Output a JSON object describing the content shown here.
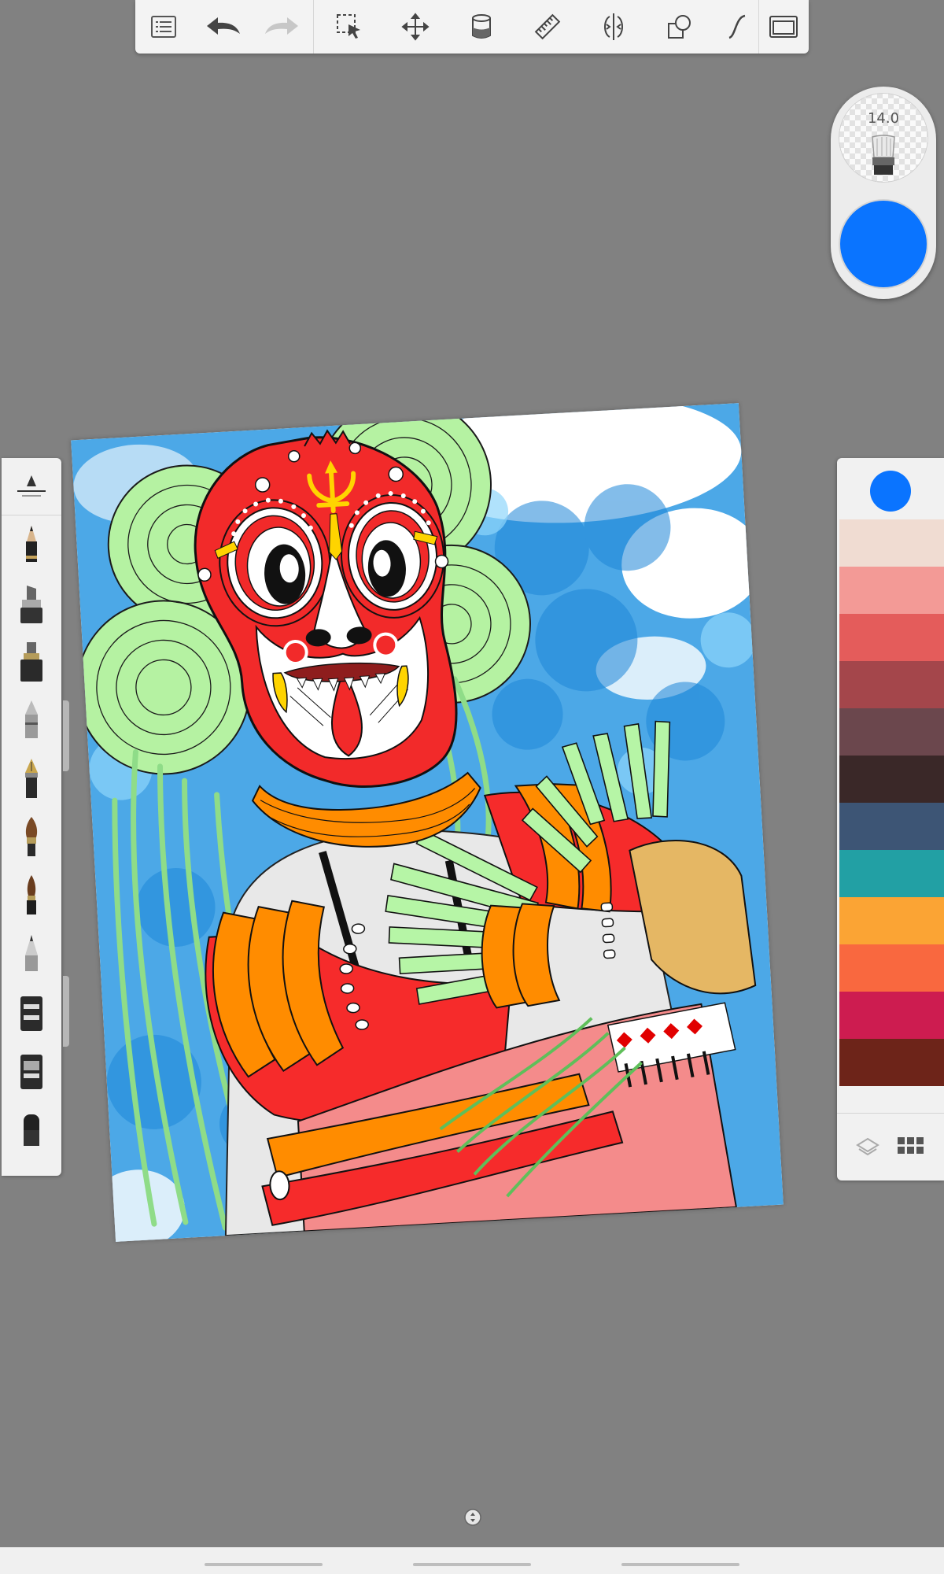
{
  "toolbar": {
    "items": [
      {
        "name": "gallery-button",
        "icon": "list-icon"
      },
      {
        "name": "undo-button",
        "icon": "undo-arrow-icon"
      },
      {
        "name": "redo-button",
        "icon": "redo-arrow-icon",
        "disabled": true
      },
      {
        "name": "selection-button",
        "icon": "selection-icon"
      },
      {
        "name": "transform-button",
        "icon": "move-arrows-icon"
      },
      {
        "name": "fill-button",
        "icon": "paint-bucket-icon"
      },
      {
        "name": "ruler-button",
        "icon": "ruler-icon"
      },
      {
        "name": "symmetry-button",
        "icon": "symmetry-icon"
      },
      {
        "name": "shapes-button",
        "icon": "shapes-icon"
      },
      {
        "name": "curve-button",
        "icon": "curve-icon"
      },
      {
        "name": "fullscreen-button",
        "icon": "fullscreen-icon"
      }
    ]
  },
  "brush_puck": {
    "size": "14.0",
    "current_color": "#0a74ff",
    "brush_icon": "brush-icon"
  },
  "brush_library": {
    "top_control": "brush-slider-icon",
    "brushes": [
      {
        "name": "pencil",
        "icon": "pencil-icon"
      },
      {
        "name": "marker",
        "icon": "marker-icon"
      },
      {
        "name": "ink-pen",
        "icon": "ink-pen-icon"
      },
      {
        "name": "airbrush",
        "icon": "airbrush-icon"
      },
      {
        "name": "fountain-pen",
        "icon": "fountain-pen-icon"
      },
      {
        "name": "paintbrush",
        "icon": "paintbrush-icon"
      },
      {
        "name": "fine-paintbrush",
        "icon": "fine-brush-icon"
      },
      {
        "name": "chisel-pen",
        "icon": "chisel-pen-icon"
      },
      {
        "name": "smudge-tool",
        "icon": "smudge-icon"
      },
      {
        "name": "blur-tool",
        "icon": "blur-icon"
      },
      {
        "name": "eraser",
        "icon": "eraser-icon"
      }
    ]
  },
  "color_panel": {
    "current_color": "#0a74ff",
    "swatches": [
      "#f0dcd2",
      "#f39a96",
      "#e45c5b",
      "#a4464b",
      "#6b474d",
      "#3a2828",
      "#3d5575",
      "#22a0a4",
      "#fba434",
      "#f9683f",
      "#cd1c50",
      "#6d2419"
    ],
    "layers_icon": "layers-icon",
    "grid_icon": "grid-icon"
  },
  "canvas": {
    "artwork": "theyyam-mask-illustration"
  },
  "canvas_controls": {
    "reset_icon": "canvas-reset-icon"
  }
}
